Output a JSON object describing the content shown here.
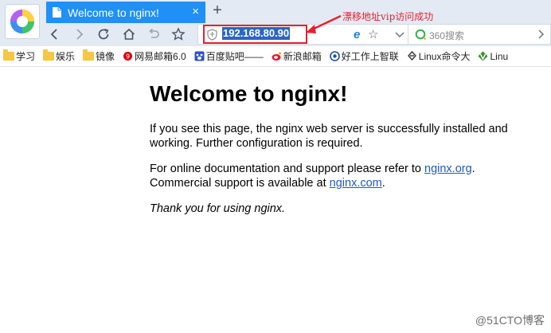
{
  "browser": {
    "tab": {
      "title": "Welcome to nginx!",
      "close": "×"
    },
    "new_tab": "+",
    "address": {
      "url": "192.168.80.90"
    },
    "search": {
      "placeholder": "360搜索"
    },
    "annotation": "漂移地址vip访问成功"
  },
  "bookmarks": [
    {
      "label": "学习",
      "icon": "folder-icon"
    },
    {
      "label": "娱乐",
      "icon": "folder-icon"
    },
    {
      "label": "镜像",
      "icon": "folder-icon"
    },
    {
      "label": "网易邮箱6.0",
      "icon": "netease-icon"
    },
    {
      "label": "百度贴吧——",
      "icon": "baidu-icon"
    },
    {
      "label": "新浪邮箱",
      "icon": "sina-icon"
    },
    {
      "label": "好工作上智联",
      "icon": "zhaopin-icon"
    },
    {
      "label": "Linux命令大",
      "icon": "linux-icon"
    },
    {
      "label": "Linu",
      "icon": "vim-icon"
    }
  ],
  "page": {
    "heading": "Welcome to nginx!",
    "p1": "If you see this page, the nginx web server is successfully installed and working. Further configuration is required.",
    "p2_prefix": "For online documentation and support please refer to ",
    "p2_link1": "nginx.org",
    "p2_mid": ".",
    "p2_line2": "Commercial support is available at ",
    "p2_link2": "nginx.com",
    "p2_end": ".",
    "p3": "Thank you for using nginx."
  },
  "watermark": "@51CTO博客",
  "colors": {
    "tab_bg": "#1e90f7",
    "highlight": "#e4222f",
    "link": "#1a5bc9",
    "selection": "#2a66c8"
  }
}
